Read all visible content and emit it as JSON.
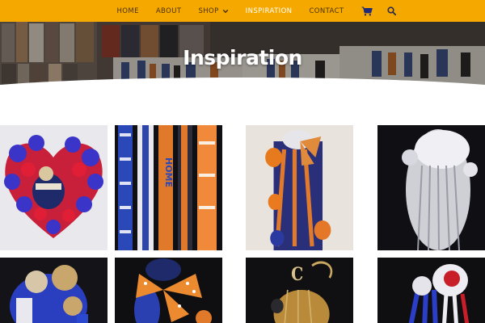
{
  "nav": {
    "items": [
      {
        "label": "HOME",
        "active": false
      },
      {
        "label": "ABOUT",
        "active": false
      },
      {
        "label": "SHOP",
        "active": false,
        "has_dropdown": true
      },
      {
        "label": "INSPIRATION",
        "active": true
      },
      {
        "label": "CONTACT",
        "active": false
      }
    ],
    "cart_icon": "cart-icon",
    "search_icon": "search-icon",
    "background_color": "#f5a800",
    "text_color": "#4a3200",
    "active_color": "#ffffff"
  },
  "hero": {
    "title": "Inspiration"
  },
  "gallery": {
    "items": [
      {
        "icon": "red-blue-feather-heart-mum-photo"
      },
      {
        "icon": "blue-orange-braid-ribbons-photo"
      },
      {
        "icon": "blue-orange-mum-with-bow-photo"
      },
      {
        "icon": "white-silver-mum-photo"
      },
      {
        "icon": "blue-mum-with-teddy-bears-photo"
      },
      {
        "icon": "orange-polka-dot-bow-mum-photo"
      },
      {
        "icon": "gold-black-mum-photo"
      },
      {
        "icon": "red-white-blue-mum-photo"
      }
    ]
  }
}
